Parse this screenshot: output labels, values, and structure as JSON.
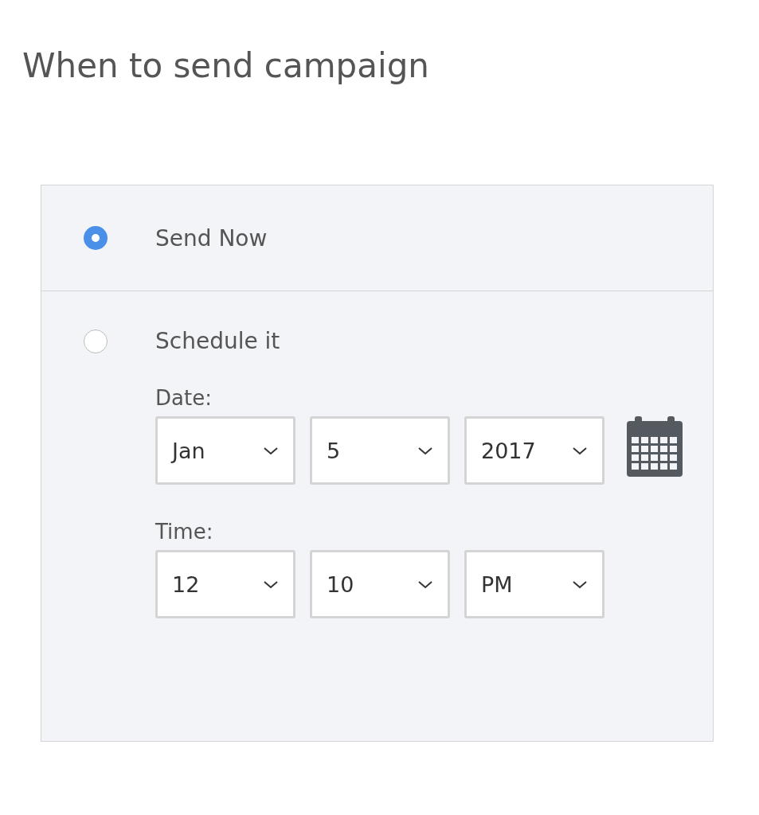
{
  "title": "When to send campaign",
  "options": [
    {
      "label": "Send Now",
      "selected": true
    },
    {
      "label": "Schedule it",
      "selected": false
    }
  ],
  "date": {
    "label": "Date:",
    "selects": [
      {
        "value": "Jan"
      },
      {
        "value": "5"
      },
      {
        "value": "2017"
      }
    ]
  },
  "time": {
    "label": "Time:",
    "selects": [
      {
        "value": "12"
      },
      {
        "value": "10"
      },
      {
        "value": "PM"
      }
    ]
  }
}
